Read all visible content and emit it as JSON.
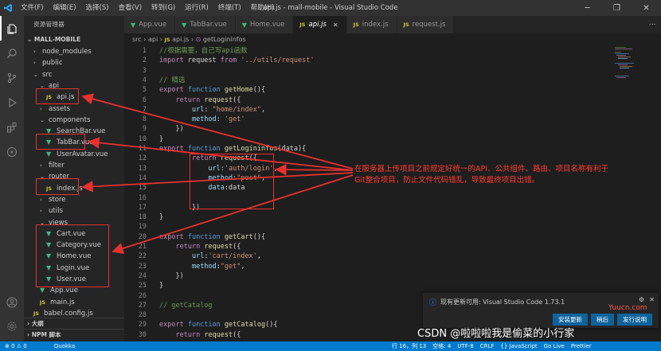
{
  "window": {
    "title": "api.js - mall-mobile - Visual Studio Code",
    "menu": [
      "文件(F)",
      "编辑(E)",
      "选择(S)",
      "查看(V)",
      "转到(G)",
      "运行(R)",
      "终端(T)",
      "帮助(H)"
    ]
  },
  "sidebar": {
    "header": "资源管理器",
    "project": "MALL-MOBILE",
    "tree": [
      {
        "label": "node_modules",
        "kind": "folder",
        "level": 1,
        "open": false
      },
      {
        "label": "public",
        "kind": "folder",
        "level": 1,
        "open": false
      },
      {
        "label": "src",
        "kind": "folder",
        "level": 1,
        "open": true
      },
      {
        "label": "api",
        "kind": "folder",
        "level": 2,
        "open": true
      },
      {
        "label": "api.js",
        "kind": "js",
        "level": 3
      },
      {
        "label": "assets",
        "kind": "folder",
        "level": 2,
        "open": false
      },
      {
        "label": "components",
        "kind": "folder",
        "level": 2,
        "open": true
      },
      {
        "label": "SearchBar.vue",
        "kind": "vue",
        "level": 3
      },
      {
        "label": "TabBar.vue",
        "kind": "vue",
        "level": 3
      },
      {
        "label": "UserAvatar.vue",
        "kind": "vue",
        "level": 3
      },
      {
        "label": "filter",
        "kind": "folder",
        "level": 2,
        "open": false
      },
      {
        "label": "router",
        "kind": "folder",
        "level": 2,
        "open": true
      },
      {
        "label": "index.js",
        "kind": "js",
        "level": 3
      },
      {
        "label": "store",
        "kind": "folder",
        "level": 2,
        "open": false
      },
      {
        "label": "utils",
        "kind": "folder",
        "level": 2,
        "open": false
      },
      {
        "label": "views",
        "kind": "folder",
        "level": 2,
        "open": true
      },
      {
        "label": "Cart.vue",
        "kind": "vue",
        "level": 3
      },
      {
        "label": "Category.vue",
        "kind": "vue",
        "level": 3
      },
      {
        "label": "Home.vue",
        "kind": "vue",
        "level": 3
      },
      {
        "label": "Login.vue",
        "kind": "vue",
        "level": 3
      },
      {
        "label": "User.vue",
        "kind": "vue",
        "level": 3
      },
      {
        "label": "App.vue",
        "kind": "vue",
        "level": 2
      },
      {
        "label": "main.js",
        "kind": "js",
        "level": 2
      },
      {
        "label": "babel.config.js",
        "kind": "js",
        "level": 1
      }
    ],
    "sections": [
      "大纲",
      "NPM 脚本"
    ]
  },
  "tabs": [
    {
      "label": "App.vue",
      "kind": "vue",
      "active": false
    },
    {
      "label": "TabBar.vue",
      "kind": "vue",
      "active": false
    },
    {
      "label": "Home.vue",
      "kind": "vue",
      "active": false
    },
    {
      "label": "api.js",
      "kind": "js",
      "active": true
    },
    {
      "label": "index.js",
      "kind": "js",
      "active": false
    },
    {
      "label": "request.js",
      "kind": "js",
      "active": false
    }
  ],
  "breadcrumb": {
    "parts": [
      "src",
      "api",
      "api.js",
      "getLogininfos"
    ]
  },
  "code_lines": [
    "//根据需要，自己写api函数",
    "import request from '../utils/request'",
    "",
    "// 精选",
    "export function getHome(){",
    "    return request({",
    "        url: \"home/index\",",
    "        method: 'get'",
    "    })",
    "}",
    "export function getLogininfos(data){",
    "        return request({",
    "            url:'auth/login',",
    "            method:\"post\",",
    "            data:data",
    "",
    "        })",
    "}",
    "",
    "export function getCart(){",
    "    return request({",
    "        url:'cart/index',",
    "        method:\"get\",",
    "    })",
    "}",
    "",
    "// getCatalog",
    "",
    "export function getCatalog(){",
    "    return request({"
  ],
  "line_numbers": [
    "1",
    "2",
    "3",
    "4",
    "5",
    "6",
    "7",
    "8",
    "9",
    "10",
    "11",
    "12",
    "13",
    "14",
    "15",
    "16",
    "17",
    "18",
    "19",
    "20",
    "21",
    "22",
    "23",
    "24",
    "25",
    "26",
    "27",
    "28",
    "29",
    "30"
  ],
  "notification": {
    "message": "现有更新可用: Visual Studio Code 1.73.1",
    "buttons": [
      "安装更新",
      "稍后",
      "发行说明"
    ]
  },
  "statusbar": {
    "left": [
      "⊗ 0 ⚠ 0",
      "Quokka"
    ],
    "right": [
      "行 16，列 13",
      "空格: 4",
      "UTF-8",
      "CRLF",
      "{} JavaScript",
      "Go Live",
      "Prettier"
    ]
  },
  "annotation": {
    "text": "在服务器上传项目之前规定好统一的API、公共组件、路由、项目名称有利于Git整合项目，防止文件代码错乱，导致最终项目出错。",
    "color": "#e8312f"
  },
  "watermarks": {
    "yuucn": "Yuucn.com",
    "csdn": "CSDN @啦啦啦我是偷菜的小行家"
  },
  "colors": {
    "accent": "#007acc",
    "annotation": "#e8312f",
    "vue": "#41b883",
    "js": "#cbcb41"
  }
}
